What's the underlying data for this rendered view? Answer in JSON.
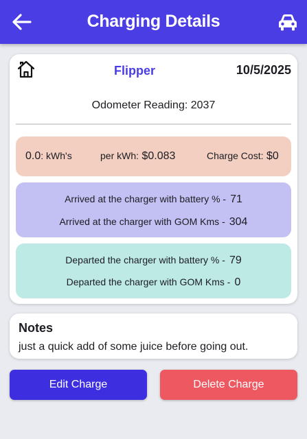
{
  "header": {
    "title": "Charging Details",
    "back_icon": "arrow-left-icon",
    "car_icon": "car-icon"
  },
  "charge": {
    "home_icon": "home-icon",
    "nickname": "Flipper",
    "date": "10/5/2025",
    "odometer_label": "Odometer Reading:",
    "odometer_value": "2037",
    "kwh_value": "0.0",
    "kwh_unit": ": kWh's",
    "per_kwh_label": "per kWh:",
    "per_kwh_value": "$0.083",
    "charge_cost_label": "Charge Cost:",
    "charge_cost_value": "$0",
    "arrived_battery_label": "Arrived at the charger with battery % -",
    "arrived_battery_value": "71",
    "arrived_gom_label": "Arrived at the charger with GOM Kms -",
    "arrived_gom_value": "304",
    "departed_battery_label": "Departed the charger with battery % -",
    "departed_battery_value": "79",
    "departed_gom_label": "Departed the charger with GOM Kms -",
    "departed_gom_value": "0"
  },
  "notes": {
    "heading": "Notes",
    "text": "just a quick add of some juice before going out."
  },
  "actions": {
    "edit_label": "Edit Charge",
    "delete_label": "Delete Charge"
  },
  "colors": {
    "primary": "#4a3de3",
    "delete": "#ee5961",
    "cost_bg": "#f2cfc1",
    "arrive_bg": "#c3c0f3",
    "depart_bg": "#bdeae5"
  }
}
